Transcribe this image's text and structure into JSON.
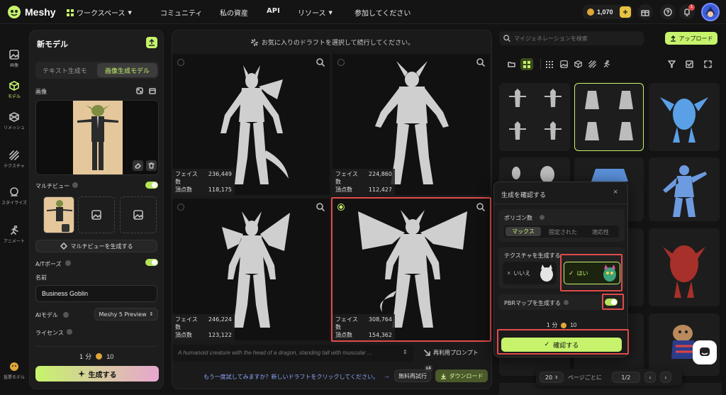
{
  "brand": {
    "name": "Meshy"
  },
  "nav": {
    "workspace": "ワークスペース",
    "community": "コミュニティ",
    "assets": "私の資産",
    "api": "API",
    "resources": "リソース",
    "join": "参加してください"
  },
  "credits": {
    "value": "1,070"
  },
  "notifications": {
    "count": "1"
  },
  "rail": [
    {
      "label": "画像"
    },
    {
      "label": "モデル"
    },
    {
      "label": "リメッシュ"
    },
    {
      "label": "テクスチャ"
    },
    {
      "label": "スタイライズ"
    },
    {
      "label": "アニメート"
    },
    {
      "label": "投票モデル"
    }
  ],
  "leftpanel": {
    "title": "新モデル",
    "tab_text": "テキスト生成モ",
    "tab_image": "画像生成モデル",
    "image_label": "画像",
    "multiview_label": "マルチビュー",
    "multiview_button": "マルチビューを生成する",
    "atpose_label": "A/Tポーズ",
    "name_label": "名前",
    "name_value": "Business Goblin",
    "ai_model_label": "AIモデル",
    "ai_model_value": "Meshy 5 Preview",
    "license_label": "ライセンス",
    "time": "1 分",
    "cost": "10",
    "generate": "生成する"
  },
  "center": {
    "hint": "お気に入りのドラフトを選択して続行してください。",
    "drafts": [
      {
        "faces_label": "フェイス数",
        "faces": "236,449",
        "verts_label": "頂点数",
        "verts": "118,175"
      },
      {
        "faces_label": "フェイス数",
        "faces": "224,860",
        "verts_label": "頂点数",
        "verts": "112,427"
      },
      {
        "faces_label": "フェイス数",
        "faces": "246,224",
        "verts_label": "頂点数",
        "verts": "123,122"
      },
      {
        "faces_label": "フェイス数",
        "faces": "308,764",
        "verts_label": "頂点数",
        "verts": "154,362"
      }
    ],
    "prompt": "A humanoid creature with the head of a dragon, standing tall with muscular ...",
    "reuse_prompt": "再利用プロンプト",
    "retry_hint": "もう一度試してみますか？新しいドラフトをクリックしてください。",
    "free_retry": "無料再試行",
    "retry_badge": "x4",
    "download": "ダウンロード"
  },
  "right": {
    "search_placeholder": "マイジェネレーションを検索",
    "upload": "アップロード",
    "page_size": "20",
    "per_page": "ページごとに",
    "page": "1/2"
  },
  "popup": {
    "title": "生成を確認する",
    "polygon_label": "ポリゴン数",
    "poly_options": [
      "マックス",
      "固定された",
      "適応性"
    ],
    "texture_label": "テクスチャを生成する",
    "no": "いいえ",
    "yes": "はい",
    "pbr_label": "PBRマップを生成する",
    "time": "1 分",
    "cost": "10",
    "confirm": "確認する"
  },
  "colors": {
    "accent": "#c6f36b",
    "highlight": "#e04b4b",
    "bg": "#131313"
  }
}
